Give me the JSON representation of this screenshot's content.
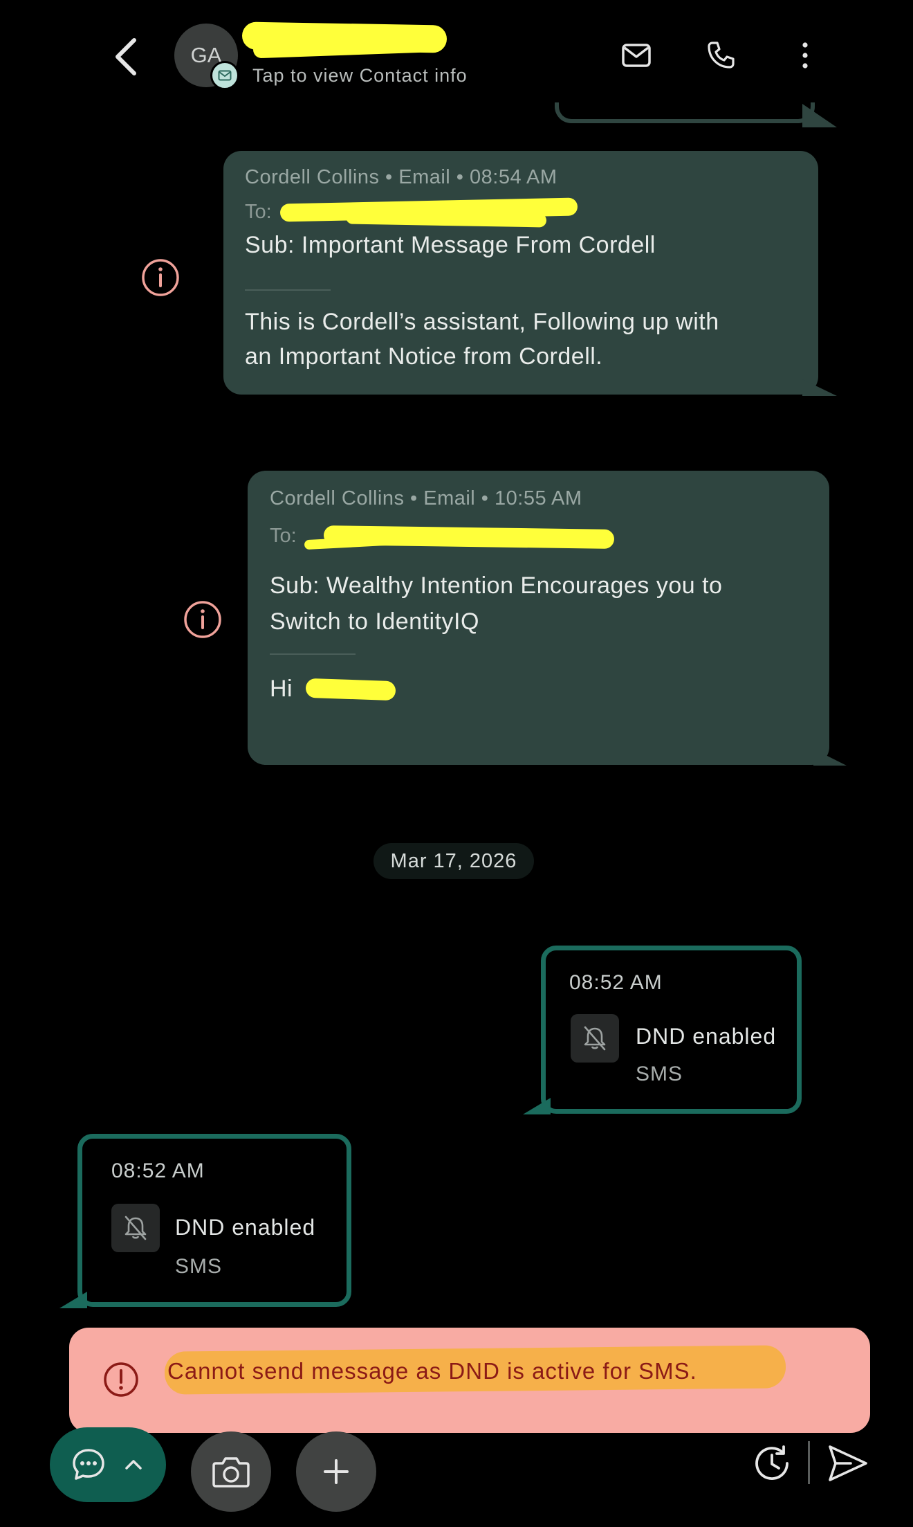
{
  "header": {
    "avatar_initials": "GA",
    "subtitle": "Tap to view Contact info",
    "icons": [
      "back-arrow-icon",
      "mail-icon",
      "phone-icon",
      "more-vertical-icon"
    ]
  },
  "messages": [
    {
      "meta": "Cordell Collins • Email • 08:54 AM",
      "to_prefix": "To:",
      "subject": "Sub: Important Message From Cordell",
      "body_lines": [
        "This is Cordell’s assistant, Following up with",
        "an Important Notice from Cordell."
      ]
    },
    {
      "meta": "Cordell Collins • Email • 10:55 AM",
      "to_prefix": "To:",
      "subject_lines": [
        "Sub: Wealthy Intention Encourages you to",
        "Switch to IdentityIQ"
      ],
      "greeting": "Hi"
    }
  ],
  "date_divider": "Mar 17, 2026",
  "dnd_events": [
    {
      "time": "08:52 AM",
      "label": "DND enabled",
      "channel": "SMS"
    },
    {
      "time": "08:52 AM",
      "label": "DND enabled",
      "channel": "SMS"
    }
  ],
  "error_banner": {
    "text": "Cannot send message as DND is active for SMS."
  },
  "colors": {
    "bubble": "#2f4540",
    "accent": "#1b6b5d",
    "error_bg": "#f8aba3",
    "error_text": "#8b1a16",
    "highlight": "#f6b04a",
    "redaction": "#ffff3a"
  }
}
